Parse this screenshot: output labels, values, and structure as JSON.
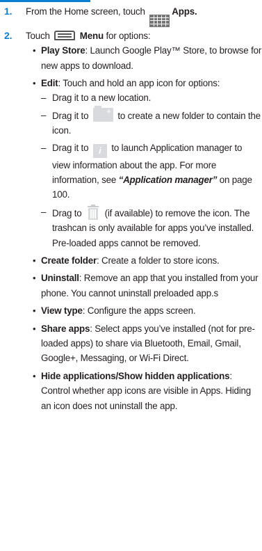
{
  "step1": {
    "num": "1.",
    "text": "From the Home screen, touch",
    "apps_label": "Apps."
  },
  "step2": {
    "num": "2.",
    "text_before": "Touch",
    "menu_label": "Menu",
    "text_after": " for options:"
  },
  "options": {
    "play_store": {
      "term": "Play Store",
      "desc": ": Launch Google Play™ Store, to browse for new apps to download."
    },
    "edit": {
      "term": "Edit",
      "desc": ": Touch and hold an app icon for options:",
      "sub": {
        "move": "Drag it to a new location.",
        "folder_before": "Drag it to",
        "folder_after": "to create a new folder to contain the icon.",
        "info_before": "Drag it to",
        "info_after": "to launch Application manager to view information about the app. For more information, see ",
        "info_ref": "“Application manager”",
        "info_page": " on page 100.",
        "trash_before": "Drag to",
        "trash_after": "(if available) to remove the icon. The trashcan is only available for apps you’ve installed. Pre-loaded apps cannot be removed."
      }
    },
    "create_folder": {
      "term": "Create folder",
      "desc": ": Create a folder to store icons."
    },
    "uninstall": {
      "term": "Uninstall",
      "desc": ": Remove an app that you installed from your phone. You cannot uninstall preloaded app.s"
    },
    "view_type": {
      "term": "View type",
      "desc": ": Configure the apps screen."
    },
    "share_apps": {
      "term": "Share apps",
      "desc": ": Select apps you’ve installed (not for pre-loaded apps) to share via Bluetooth, Email, Gmail, Google+, Messaging, or Wi-Fi Direct."
    },
    "hide_apps": {
      "term": "Hide applications/Show hidden applications",
      "desc": ": Control whether app icons are visible in Apps. Hiding an icon does not uninstall the app."
    }
  },
  "icons": {
    "apps": "apps-grid-icon",
    "menu": "menu-key-icon",
    "folder": "new-folder-icon",
    "info": "app-info-icon",
    "trash": "trashcan-icon"
  },
  "colors": {
    "step_number": "#0a7fd1",
    "text": "#231f20",
    "icon_gray": "#d8dadd"
  }
}
